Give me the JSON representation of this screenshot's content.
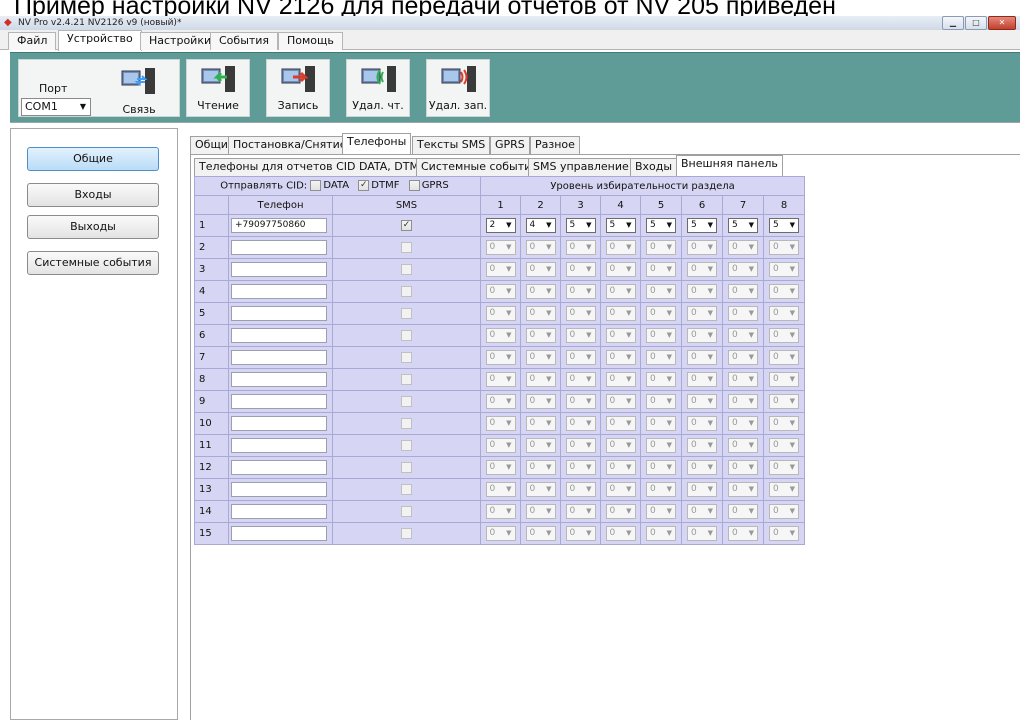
{
  "caption": "Пример настройки NV 2126 для передачи отчетов от NV 205 приведен",
  "window": {
    "title": "NV Pro v2.4.21 NV2126 v9 (новый)*"
  },
  "menu": [
    "Файл",
    "Устройство",
    "Настройки",
    "События",
    "Помощь"
  ],
  "toolbar": {
    "port_label": "Порт",
    "port_value": "COM1",
    "buttons": [
      "Связь",
      "Чтение",
      "Запись",
      "Удал. чт.",
      "Удал. зап."
    ]
  },
  "nav": [
    "Общие",
    "Входы",
    "Выходы",
    "Системные события"
  ],
  "tabs_main": [
    "Общие",
    "Постановка/Снятие",
    "Телефоны",
    "Тексты SMS",
    "GPRS",
    "Разное"
  ],
  "tabs_sub": [
    "Телефоны для отчетов CID DATA, DTMF",
    "Системные события",
    "SMS управление",
    "Входы",
    "Внешняя панель"
  ],
  "grid": {
    "send_cid_label": "Отправлять CID:",
    "cid_options": [
      {
        "label": "DATA",
        "checked": false
      },
      {
        "label": "DTMF",
        "checked": true
      },
      {
        "label": "GPRS",
        "checked": false
      }
    ],
    "level_header": "Уровень избирательности раздела",
    "col_phone": "Телефон",
    "col_sms": "SMS",
    "partition_cols": [
      "1",
      "2",
      "3",
      "4",
      "5",
      "6",
      "7",
      "8"
    ],
    "rows": [
      {
        "n": "1",
        "phone": "+79097750860",
        "sms": true,
        "levels": [
          "2",
          "4",
          "5",
          "5",
          "5",
          "5",
          "5",
          "5"
        ]
      },
      {
        "n": "2",
        "phone": "",
        "sms": false,
        "levels": [
          "0",
          "0",
          "0",
          "0",
          "0",
          "0",
          "0",
          "0"
        ]
      },
      {
        "n": "3",
        "phone": "",
        "sms": false,
        "levels": [
          "0",
          "0",
          "0",
          "0",
          "0",
          "0",
          "0",
          "0"
        ]
      },
      {
        "n": "4",
        "phone": "",
        "sms": false,
        "levels": [
          "0",
          "0",
          "0",
          "0",
          "0",
          "0",
          "0",
          "0"
        ]
      },
      {
        "n": "5",
        "phone": "",
        "sms": false,
        "levels": [
          "0",
          "0",
          "0",
          "0",
          "0",
          "0",
          "0",
          "0"
        ]
      },
      {
        "n": "6",
        "phone": "",
        "sms": false,
        "levels": [
          "0",
          "0",
          "0",
          "0",
          "0",
          "0",
          "0",
          "0"
        ]
      },
      {
        "n": "7",
        "phone": "",
        "sms": false,
        "levels": [
          "0",
          "0",
          "0",
          "0",
          "0",
          "0",
          "0",
          "0"
        ]
      },
      {
        "n": "8",
        "phone": "",
        "sms": false,
        "levels": [
          "0",
          "0",
          "0",
          "0",
          "0",
          "0",
          "0",
          "0"
        ]
      },
      {
        "n": "9",
        "phone": "",
        "sms": false,
        "levels": [
          "0",
          "0",
          "0",
          "0",
          "0",
          "0",
          "0",
          "0"
        ]
      },
      {
        "n": "10",
        "phone": "",
        "sms": false,
        "levels": [
          "0",
          "0",
          "0",
          "0",
          "0",
          "0",
          "0",
          "0"
        ]
      },
      {
        "n": "11",
        "phone": "",
        "sms": false,
        "levels": [
          "0",
          "0",
          "0",
          "0",
          "0",
          "0",
          "0",
          "0"
        ]
      },
      {
        "n": "12",
        "phone": "",
        "sms": false,
        "levels": [
          "0",
          "0",
          "0",
          "0",
          "0",
          "0",
          "0",
          "0"
        ]
      },
      {
        "n": "13",
        "phone": "",
        "sms": false,
        "levels": [
          "0",
          "0",
          "0",
          "0",
          "0",
          "0",
          "0",
          "0"
        ]
      },
      {
        "n": "14",
        "phone": "",
        "sms": false,
        "levels": [
          "0",
          "0",
          "0",
          "0",
          "0",
          "0",
          "0",
          "0"
        ]
      },
      {
        "n": "15",
        "phone": "",
        "sms": false,
        "levels": [
          "0",
          "0",
          "0",
          "0",
          "0",
          "0",
          "0",
          "0"
        ]
      }
    ]
  }
}
